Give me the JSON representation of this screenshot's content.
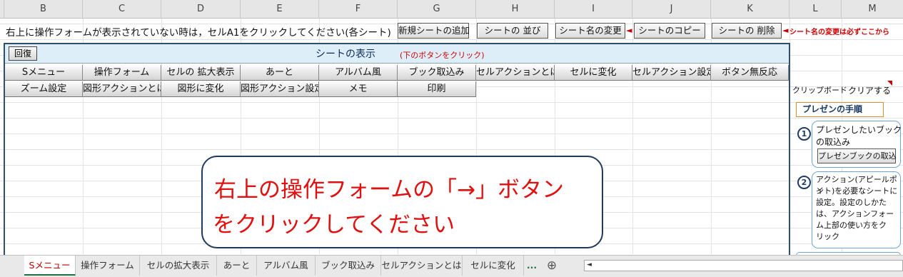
{
  "columns": [
    "B",
    "C",
    "D",
    "E",
    "F",
    "G",
    "H",
    "I",
    "J",
    "K",
    "L",
    "M"
  ],
  "info_text": "右上に操作フォームが表示されていない時は，セルA1をクリックしてください(各シート)",
  "top_buttons": [
    "新規シートの追加",
    "シートの 並び",
    "シート名の変更",
    "シートのコピー",
    "シートの 削除"
  ],
  "arrow_glyph": "◄",
  "warning_text": "シート名の変更は必ずここから",
  "panel": {
    "restore_button": "回復",
    "title": "シートの表示",
    "note": "(下のボタンをクリック)"
  },
  "menu_row1": [
    "Sメニュー",
    "操作フォーム",
    "セルの 拡大表示",
    "あーと",
    "アルバム風",
    "ブック取込み",
    "セルアクションとは",
    "セルに変化",
    "セルアクション設定",
    "ボタン無反応"
  ],
  "menu_row2": [
    "ズーム設定",
    "図形アクションとは",
    "図形に変化",
    "図形アクション設定",
    "メモ",
    "印刷"
  ],
  "message": {
    "line1": "右上の操作フォームの「→」ボタン",
    "line2": "をクリックしてください"
  },
  "right_panel": {
    "clipboard_label": "クリップボード",
    "clear_label": "クリアする",
    "presentation_title": "プレゼンの手順",
    "step1": {
      "number": "1",
      "text_line1": "プレゼンしたいブック",
      "text_line2": "の取込み",
      "button": "プレゼンブックの取込"
    },
    "step2": {
      "number": "2",
      "text": [
        "アクション(アピールポイ",
        "ント)を必要なシートに",
        "設定。設定のしかた",
        "は、アクションフォー",
        "ム上部の使い方をク",
        "リック"
      ]
    }
  },
  "sheet_tabs": [
    "Sメニュー",
    "操作フォーム",
    "セルの拡大表示",
    "あーと",
    "アルバム風",
    "ブック取込み",
    "セルアクションとは",
    "セルに変化"
  ],
  "tab_more": "...",
  "tab_add": "⊕",
  "scroll_left": "◄",
  "colors": {
    "accent_red": "#e01010",
    "panel_border": "#2f4f6f",
    "active_tab_green": "#1e7145"
  }
}
